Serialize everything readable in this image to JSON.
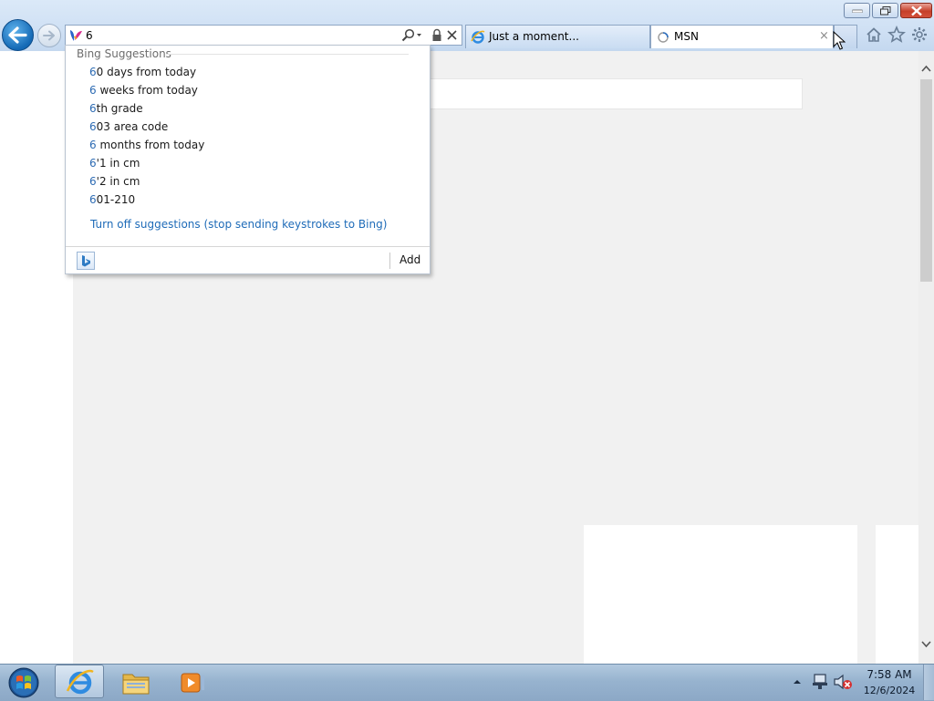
{
  "window": {
    "controls": {
      "minimize": "minimize",
      "restore": "restore",
      "close": "close"
    }
  },
  "address_bar": {
    "value": "6"
  },
  "tabs": [
    {
      "title": "Just a moment...",
      "icon": "ie-icon"
    },
    {
      "title": "MSN",
      "icon": "loading-spinner-icon",
      "close": "×"
    }
  ],
  "toolbar_icons": [
    "home-icon",
    "favorites-star-icon",
    "tools-gear-icon"
  ],
  "suggestions": {
    "header": "Bing Suggestions",
    "items": [
      {
        "match": "6",
        "rest": "0 days from today"
      },
      {
        "match": "6",
        "rest": " weeks from today"
      },
      {
        "match": "6",
        "rest": "th grade"
      },
      {
        "match": "6",
        "rest": "03 area code"
      },
      {
        "match": "6",
        "rest": " months from today"
      },
      {
        "match": "6",
        "rest": "'1 in cm"
      },
      {
        "match": "6",
        "rest": "'2 in cm"
      },
      {
        "match": "6",
        "rest": "01-210"
      }
    ],
    "turn_off_link": "Turn off suggestions (stop sending keystrokes to Bing)",
    "add_button": "Add"
  },
  "taskbar": {
    "time": "7:58 AM",
    "date": "12/6/2024"
  },
  "colors": {
    "accent": "#1469b5",
    "link": "#1e6bb8",
    "match_highlight": "#2d6bb3"
  }
}
